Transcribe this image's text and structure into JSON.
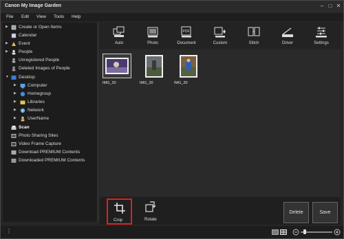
{
  "window": {
    "title": "Canon My Image Garden"
  },
  "menu": [
    "File",
    "Edit",
    "View",
    "Tools",
    "Help"
  ],
  "sidebar": {
    "items": [
      {
        "label": "Create or Open Items",
        "arrow": "▶",
        "bold": false
      },
      {
        "label": "Calendar",
        "arrow": "",
        "bold": false
      },
      {
        "label": "Event",
        "arrow": "▶",
        "bold": false
      },
      {
        "label": "People",
        "arrow": "▶",
        "bold": false
      },
      {
        "label": "Unregistered People",
        "arrow": "",
        "bold": false
      },
      {
        "label": "Deleted Images of People",
        "arrow": "",
        "bold": false
      },
      {
        "label": "Desktop",
        "arrow": "▼",
        "bold": false
      },
      {
        "label": "Computer",
        "arrow": "▶",
        "bold": false
      },
      {
        "label": "Homegroup",
        "arrow": "▶",
        "bold": false
      },
      {
        "label": "Libraries",
        "arrow": "▶",
        "bold": false
      },
      {
        "label": "Network",
        "arrow": "▶",
        "bold": false
      },
      {
        "label": "UserName",
        "arrow": "▶",
        "bold": false
      },
      {
        "label": "Scan",
        "arrow": "",
        "bold": true
      },
      {
        "label": "Photo Sharing Sites",
        "arrow": "",
        "bold": false
      },
      {
        "label": "Video Frame Capture",
        "arrow": "",
        "bold": false
      },
      {
        "label": "Download PREMIUM Contents",
        "arrow": "",
        "bold": false
      },
      {
        "label": "Downloaded PREMIUM Contents",
        "arrow": "",
        "bold": false
      }
    ]
  },
  "toolbar": {
    "buttons": [
      {
        "label": "Auto",
        "icon": "auto-scan-icon"
      },
      {
        "label": "Photo",
        "icon": "photo-scan-icon"
      },
      {
        "label": "Document",
        "icon": "document-scan-icon"
      },
      {
        "label": "Custom",
        "icon": "custom-scan-icon"
      },
      {
        "label": "Stitch",
        "icon": "stitch-icon"
      },
      {
        "label": "Driver",
        "icon": "driver-icon"
      },
      {
        "label": "Settings",
        "icon": "settings-icon"
      }
    ]
  },
  "thumbnails": [
    {
      "name": "IMG_20"
    },
    {
      "name": "IMG_20"
    },
    {
      "name": "IMG_20"
    }
  ],
  "bottom": {
    "crop_label": "Crop",
    "rotate_label": "Rotate",
    "delete_label": "Delete",
    "save_label": "Save"
  },
  "colors": {
    "highlight": "#e02020",
    "background": "#262626"
  }
}
